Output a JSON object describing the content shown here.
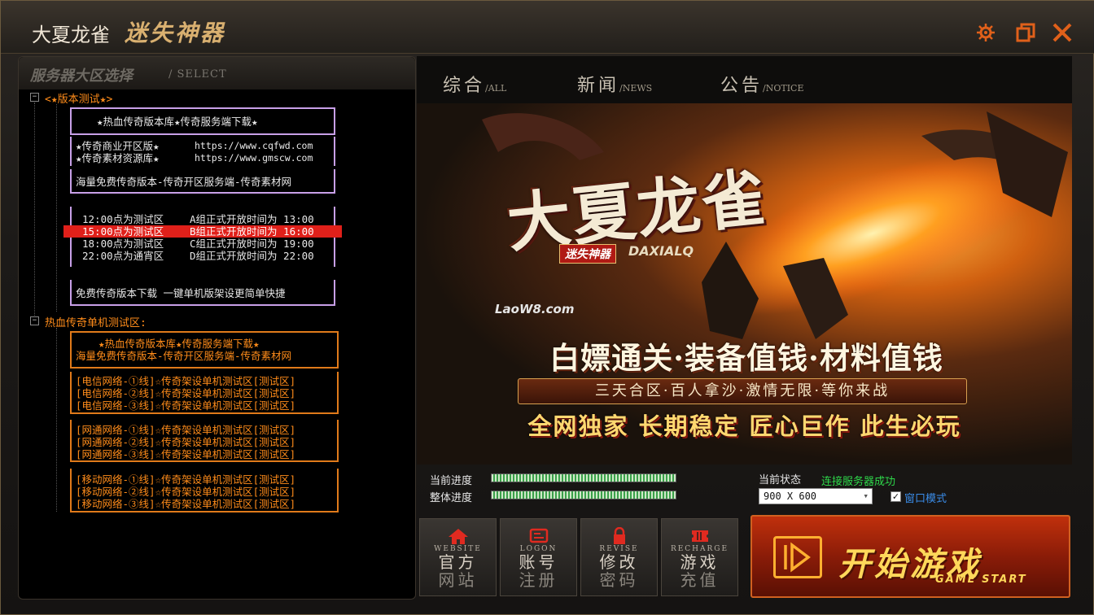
{
  "window": {
    "title": "大夏龙雀",
    "subtitle": "迷失神器"
  },
  "left_panel": {
    "heading_cn": "服务器大区选择",
    "heading_en": "/ SELECT"
  },
  "tree": {
    "group1": {
      "label": "<★版本测试★>",
      "ad_title": "★热血传奇版本库★传奇服务端下载★",
      "link1_label": "★传奇商业开区版★",
      "link1_url": "https://www.cqfwd.com",
      "link2_label": "★传奇素材资源库★",
      "link2_url": "https://www.gmscw.com",
      "ad_line2": "海量免费传奇版本-传奇开区服务端-传奇素材网",
      "servers": [
        {
          "left": "12:00点为测试区",
          "right": "A组正式开放时间为 13:00"
        },
        {
          "left": "15:00点为测试区",
          "right": "B组正式开放时间为 16:00"
        },
        {
          "left": "18:00点为测试区",
          "right": "C组正式开放时间为 19:00"
        },
        {
          "left": "22:00点为通宵区",
          "right": "D组正式开放时间为 22:00"
        }
      ],
      "download_line": "免费传奇版本下载  一键单机版架设更简单快捷"
    },
    "group2": {
      "label": "热血传奇单机测试区:",
      "ad_title": "★热血传奇版本库★传奇服务端下载★",
      "ad_line2": "海量免费传奇版本-传奇开区服务端-传奇素材网",
      "telecom": [
        "[电信网络-①线]☆传奇架设单机测试区[测试区]",
        "[电信网络-②线]☆传奇架设单机测试区[测试区]",
        "[电信网络-③线]☆传奇架设单机测试区[测试区]"
      ],
      "netcom": [
        "[网通网络-①线]☆传奇架设单机测试区[测试区]",
        "[网通网络-②线]☆传奇架设单机测试区[测试区]",
        "[网通网络-③线]☆传奇架设单机测试区[测试区]"
      ],
      "mobile": [
        "[移动网络-①线]☆传奇架设单机测试区[测试区]",
        "[移动网络-②线]☆传奇架设单机测试区[测试区]",
        "[移动网络-③线]☆传奇架设单机测试区[测试区]"
      ]
    }
  },
  "tabs": [
    {
      "cn": "综合",
      "en": "/ALL"
    },
    {
      "cn": "新闻",
      "en": "/NEWS"
    },
    {
      "cn": "公告",
      "en": "/NOTICE"
    }
  ],
  "banner": {
    "logo": "大夏龙雀",
    "logo_tag": "迷失神器",
    "logo_en": "DAXIALQ",
    "site": "LaoW8.com",
    "slogan": "白嫖通关·装备值钱·材料值钱",
    "ribbon": "三天合区·百人拿沙·激情无限·等你来战",
    "slogan2": "全网独家 长期稳定 匠心巨作 此生必玩"
  },
  "progress": {
    "current_label": "当前进度",
    "total_label": "整体进度",
    "current_value": 1.0,
    "total_value": 1.0
  },
  "status": {
    "label": "当前状态",
    "value": "连接服务器成功",
    "resolution": "900 X 600",
    "window_mode_label": "窗口模式",
    "window_mode_checked": true
  },
  "buttons": [
    {
      "en": "WEBSITE",
      "cn1": "官方",
      "cn2": "网站",
      "icon": "home-icon"
    },
    {
      "en": "LOGON",
      "cn1": "账号",
      "cn2": "注册",
      "icon": "id-card-icon"
    },
    {
      "en": "REVISE",
      "cn1": "修改",
      "cn2": "密码",
      "icon": "lock-icon"
    },
    {
      "en": "RECHARGE",
      "cn1": "游戏",
      "cn2": "充值",
      "icon": "ticket-icon"
    }
  ],
  "start": {
    "cn": "开始游戏",
    "en": "GAME START"
  },
  "colors": {
    "accent": "#e0601a",
    "tree_orange": "#ff8c1a",
    "selected_row": "#e0201a",
    "status_green": "#2ed84a"
  }
}
